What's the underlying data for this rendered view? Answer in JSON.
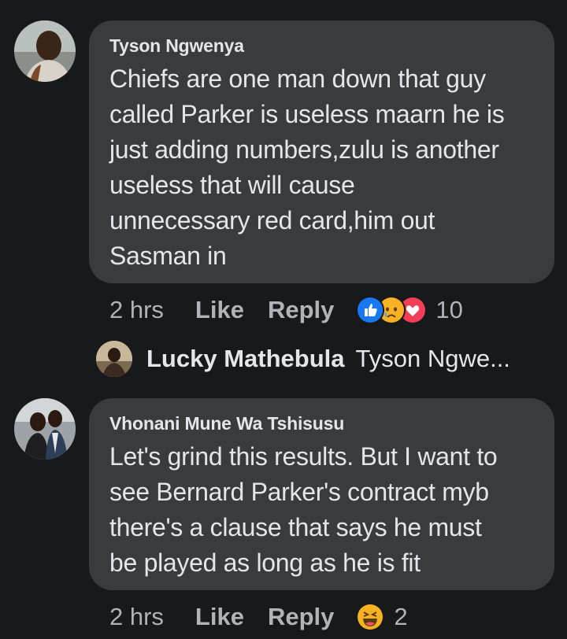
{
  "comments": [
    {
      "author": "Tyson Ngwenya",
      "text_lines": [
        "Chiefs are one man down that guy",
        "called Parker is useless maarn he is",
        "just adding numbers,zulu is another",
        "useless that will cause",
        "unnecessary red card,him out",
        "Sasman in"
      ],
      "time": "2 hrs",
      "like_label": "Like",
      "reply_label": "Reply",
      "reaction_icons": [
        "like-icon",
        "sad-icon",
        "love-icon"
      ],
      "reaction_count": "10"
    },
    {
      "author": "Vhonani Mune Wa Tshisusu",
      "text_lines": [
        "Let's grind this results. But I want to",
        "see Bernard Parker's contract myb",
        "there's a clause that says he must",
        "be played as long as he is fit"
      ],
      "time": "2 hrs",
      "like_label": "Like",
      "reply_label": "Reply",
      "reaction_icons": [
        "haha-icon"
      ],
      "reaction_count": "2"
    }
  ],
  "reply_preview": {
    "author": "Lucky Mathebula",
    "text": "Tyson Ngwe..."
  },
  "colors": {
    "background": "#18191a",
    "bubble": "#3a3b3c",
    "text_primary": "#e4e6eb",
    "text_secondary": "#b0b3b8",
    "like_blue": "#1877f2",
    "love_red": "#f33e58",
    "reaction_yellow": "#f7b125"
  }
}
